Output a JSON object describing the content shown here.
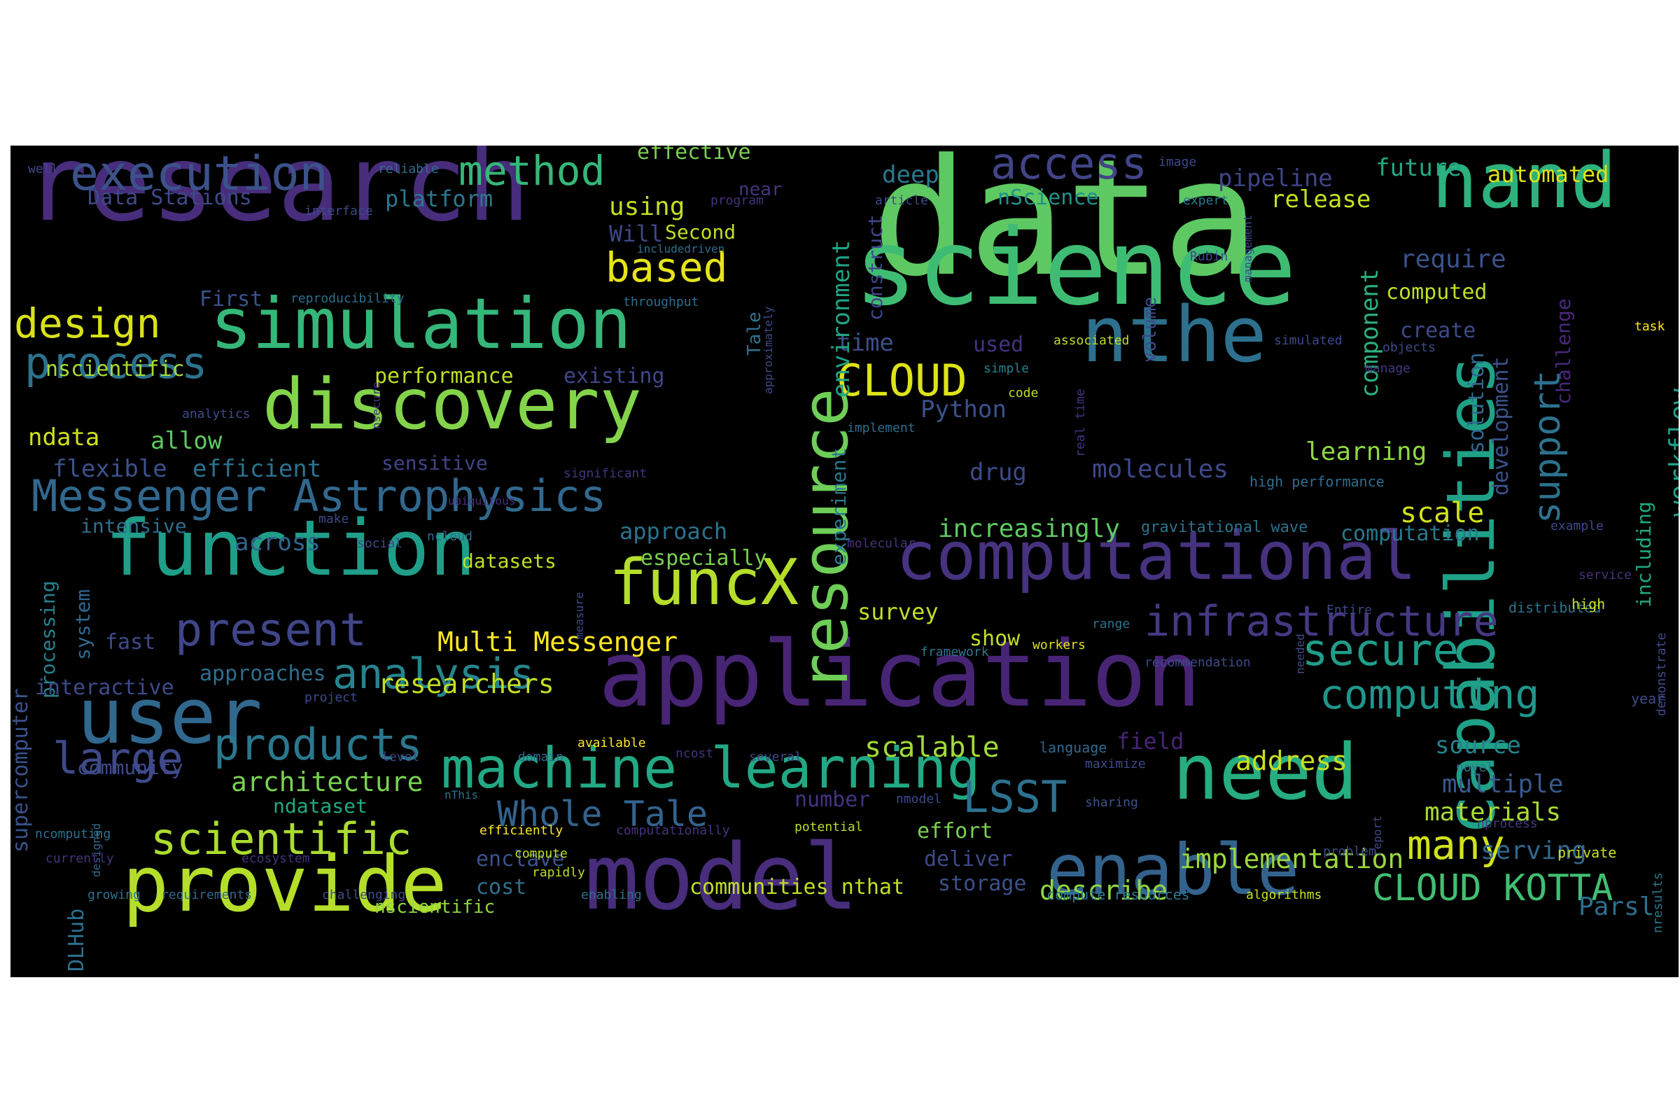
{
  "words": [
    {
      "text": "data",
      "color": "#5ec962"
    },
    {
      "text": "science",
      "color": "#3fbc73"
    },
    {
      "text": "research",
      "color": "#472d7b"
    },
    {
      "text": "application",
      "color": "#482475"
    },
    {
      "text": "model",
      "color": "#472d7b"
    },
    {
      "text": "function",
      "color": "#1f9e89"
    },
    {
      "text": "simulation",
      "color": "#35b779"
    },
    {
      "text": "discovery",
      "color": "#84d44b"
    },
    {
      "text": "computational",
      "color": "#46327e"
    },
    {
      "text": "capabilities",
      "color": "#1fa187"
    },
    {
      "text": "resource",
      "color": "#6ece58"
    },
    {
      "text": "nand",
      "color": "#2db27d"
    },
    {
      "text": "nthe",
      "color": "#2d708e"
    },
    {
      "text": "user",
      "color": "#31688e"
    },
    {
      "text": "provide",
      "color": "#b5de2b"
    },
    {
      "text": "enable",
      "color": "#33638d"
    },
    {
      "text": "need",
      "color": "#26ad81"
    },
    {
      "text": "funcX",
      "color": "#b5de2b"
    },
    {
      "text": "machine learning",
      "color": "#22a884"
    },
    {
      "text": "Messenger Astrophysics",
      "color": "#31688e"
    },
    {
      "text": "execution",
      "color": "#3b528b"
    },
    {
      "text": "access",
      "color": "#414487"
    },
    {
      "text": "infrastructure",
      "color": "#443983"
    },
    {
      "text": "present",
      "color": "#404688"
    },
    {
      "text": "large",
      "color": "#3e4a89"
    },
    {
      "text": "products",
      "color": "#2a788e"
    },
    {
      "text": "scientific",
      "color": "#addc30"
    },
    {
      "text": "analysis",
      "color": "#25858e"
    },
    {
      "text": "process",
      "color": "#2c728e"
    },
    {
      "text": "design",
      "color": "#d8e219"
    },
    {
      "text": "method",
      "color": "#35b779"
    },
    {
      "text": "based",
      "color": "#e5e419"
    },
    {
      "text": "CLOUD",
      "color": "#dde318"
    },
    {
      "text": "secure",
      "color": "#1f9e89"
    },
    {
      "text": "computing",
      "color": "#1f968b"
    },
    {
      "text": "many",
      "color": "#d0e11c"
    },
    {
      "text": "CLOUD KOTTA",
      "color": "#42be71"
    },
    {
      "text": "LSST",
      "color": "#2c728e"
    },
    {
      "text": "Whole Tale",
      "color": "#33638d"
    },
    {
      "text": "support",
      "color": "#2c728e"
    },
    {
      "text": "workflow",
      "color": "#1f9e89"
    },
    {
      "text": "Multi Messenger",
      "color": "#fde725"
    },
    {
      "text": "researchers",
      "color": "#c2df23"
    },
    {
      "text": "scalable",
      "color": "#a2da37"
    },
    {
      "text": "architecture",
      "color": "#7ad151"
    },
    {
      "text": "implementation",
      "color": "#9bd93c"
    },
    {
      "text": "describe",
      "color": "#90d743"
    },
    {
      "text": "address",
      "color": "#c8e020"
    },
    {
      "text": "multiple",
      "color": "#38588c"
    },
    {
      "text": "materials",
      "color": "#a8db34"
    },
    {
      "text": "serving",
      "color": "#31688e"
    },
    {
      "text": "Parsl",
      "color": "#2e6e8e"
    },
    {
      "text": "source",
      "color": "#26828e"
    },
    {
      "text": "learning",
      "color": "#90d743"
    },
    {
      "text": "molecules",
      "color": "#3e4989"
    },
    {
      "text": "increasingly",
      "color": "#5ec962"
    },
    {
      "text": "scale",
      "color": "#d2e21b"
    },
    {
      "text": "computation",
      "color": "#2a788e"
    },
    {
      "text": "drug",
      "color": "#3e4a89"
    },
    {
      "text": "Python",
      "color": "#3b528b"
    },
    {
      "text": "time",
      "color": "#3d4e8a"
    },
    {
      "text": "used",
      "color": "#46327e"
    },
    {
      "text": "deep",
      "color": "#2a788e"
    },
    {
      "text": "nScience",
      "color": "#21918c"
    },
    {
      "text": "pipeline",
      "color": "#414487"
    },
    {
      "text": "release",
      "color": "#c8e020"
    },
    {
      "text": "future",
      "color": "#22a884"
    },
    {
      "text": "automated",
      "color": "#dde318"
    },
    {
      "text": "require",
      "color": "#3b528b"
    },
    {
      "text": "computed",
      "color": "#bddf26"
    },
    {
      "text": "create",
      "color": "#3e4a89"
    },
    {
      "text": "component",
      "color": "#2db27d"
    },
    {
      "text": "solution",
      "color": "#31688e"
    },
    {
      "text": "development",
      "color": "#3b528b"
    },
    {
      "text": "challenge",
      "color": "#482878"
    },
    {
      "text": "including",
      "color": "#22a884"
    },
    {
      "text": "environment",
      "color": "#20a486"
    },
    {
      "text": "construct",
      "color": "#3f4788"
    },
    {
      "text": "experiment",
      "color": "#2a788e"
    },
    {
      "text": "volume",
      "color": "#3e4a89"
    },
    {
      "text": "effective",
      "color": "#7ad151"
    },
    {
      "text": "using",
      "color": "#c2df23"
    },
    {
      "text": "platform",
      "color": "#2a788e"
    },
    {
      "text": "Will",
      "color": "#404688"
    },
    {
      "text": "Second",
      "color": "#c0df25"
    },
    {
      "text": "near",
      "color": "#46337e"
    },
    {
      "text": "Data Stations",
      "color": "#3e4989"
    },
    {
      "text": "First",
      "color": "#3b528b"
    },
    {
      "text": "Tale",
      "color": "#2c728e"
    },
    {
      "text": "nscientific",
      "color": "#a5db36"
    },
    {
      "text": "performance",
      "color": "#bddf26"
    },
    {
      "text": "existing",
      "color": "#404688"
    },
    {
      "text": "ndata",
      "color": "#d0e11c"
    },
    {
      "text": "allow",
      "color": "#5ec962"
    },
    {
      "text": "flexible",
      "color": "#3b528b"
    },
    {
      "text": "efficient",
      "color": "#2c728e"
    },
    {
      "text": "sensitive",
      "color": "#414487"
    },
    {
      "text": "intensive",
      "color": "#2e6e8e"
    },
    {
      "text": "across",
      "color": "#33638d"
    },
    {
      "text": "approach",
      "color": "#2c728e"
    },
    {
      "text": "datasets",
      "color": "#bddf26"
    },
    {
      "text": "especially",
      "color": "#7ad151"
    },
    {
      "text": "system",
      "color": "#31688e"
    },
    {
      "text": "processing",
      "color": "#26828e"
    },
    {
      "text": "supercomputer",
      "color": "#3b528b"
    },
    {
      "text": "fast",
      "color": "#3e4a89"
    },
    {
      "text": "interactive",
      "color": "#3e4a89"
    },
    {
      "text": "approaches",
      "color": "#2e6e8e"
    },
    {
      "text": "community",
      "color": "#3e4a89"
    },
    {
      "text": "ndataset",
      "color": "#22a884"
    },
    {
      "text": "nscientific",
      "color": "#8fd744"
    },
    {
      "text": "cost",
      "color": "#2d708e"
    },
    {
      "text": "communities nthat",
      "color": "#c0df25"
    },
    {
      "text": "enclave",
      "color": "#3b528b"
    },
    {
      "text": "storage",
      "color": "#3b528b"
    },
    {
      "text": "deliver",
      "color": "#3e4a89"
    },
    {
      "text": "effort",
      "color": "#7ad151"
    },
    {
      "text": "number",
      "color": "#46337e"
    },
    {
      "text": "field",
      "color": "#482475"
    },
    {
      "text": "show",
      "color": "#c0df25"
    },
    {
      "text": "survey",
      "color": "#c0df25"
    },
    {
      "text": "DLHub",
      "color": "#2d708e"
    },
    {
      "text": "nprocess",
      "color": "#44397f"
    },
    {
      "text": "private",
      "color": "#c8e020"
    },
    {
      "text": "nresults",
      "color": "#2a788e"
    },
    {
      "text": "year",
      "color": "#3e4a89"
    },
    {
      "text": "demonstrate",
      "color": "#3e4a89"
    },
    {
      "text": "distributed",
      "color": "#2c728e"
    },
    {
      "text": "service",
      "color": "#46327e"
    },
    {
      "text": "high",
      "color": "#c8e020"
    },
    {
      "text": "example",
      "color": "#3e4a89"
    },
    {
      "text": "task",
      "color": "#fde725"
    },
    {
      "text": "gravitational wave",
      "color": "#2c728e"
    },
    {
      "text": "high performance",
      "color": "#2e6e8e"
    },
    {
      "text": "real time",
      "color": "#46327e"
    },
    {
      "text": "compute resources",
      "color": "#2a788e"
    },
    {
      "text": "algorithms",
      "color": "#c8e020"
    },
    {
      "text": "rapidly",
      "color": "#bddf26"
    },
    {
      "text": "compute",
      "color": "#bddf26"
    },
    {
      "text": "enabling",
      "color": "#2e6e8e"
    },
    {
      "text": "challenging",
      "color": "#3e4a89"
    },
    {
      "text": "requirements",
      "color": "#31688e"
    },
    {
      "text": "growing",
      "color": "#2c728e"
    },
    {
      "text": "designed",
      "color": "#31688e"
    },
    {
      "text": "ecosystem",
      "color": "#46327e"
    },
    {
      "text": "efficiently",
      "color": "#fde725"
    },
    {
      "text": "computationally",
      "color": "#46337e"
    },
    {
      "text": "potential",
      "color": "#b5de2b"
    },
    {
      "text": "sharing",
      "color": "#3b528b"
    },
    {
      "text": "problem",
      "color": "#3e4a89"
    },
    {
      "text": "report",
      "color": "#3e4a89"
    },
    {
      "text": "novel",
      "color": "#2a788e"
    },
    {
      "text": "maximize",
      "color": "#3e4a89"
    },
    {
      "text": "language",
      "color": "#31688e"
    },
    {
      "text": "nmodel",
      "color": "#3e4a89"
    },
    {
      "text": "nThis",
      "color": "#2c728e"
    },
    {
      "text": "several",
      "color": "#3e4a89"
    },
    {
      "text": "ncost",
      "color": "#46327e"
    },
    {
      "text": "available",
      "color": "#fde725"
    },
    {
      "text": "domain",
      "color": "#31688e"
    },
    {
      "text": "recommendation",
      "color": "#3e4a89"
    },
    {
      "text": "range",
      "color": "#2c728e"
    },
    {
      "text": "workers",
      "color": "#dde318"
    },
    {
      "text": "framework",
      "color": "#2a788e"
    },
    {
      "text": "Entire",
      "color": "#3e4a89"
    },
    {
      "text": "measure",
      "color": "#3e4a89"
    },
    {
      "text": "molecular",
      "color": "#46327e"
    },
    {
      "text": "social",
      "color": "#3e4a89"
    },
    {
      "text": "ncloud",
      "color": "#31688e"
    },
    {
      "text": "ubiquitous",
      "color": "#46327e"
    },
    {
      "text": "make",
      "color": "#3e4a89"
    },
    {
      "text": "significant",
      "color": "#46327e"
    },
    {
      "text": "implement",
      "color": "#2e6e8e"
    },
    {
      "text": "simple",
      "color": "#26828e"
    },
    {
      "text": "code",
      "color": "#bddf26"
    },
    {
      "text": "manage",
      "color": "#44397f"
    },
    {
      "text": "simulated",
      "color": "#3e4a89"
    },
    {
      "text": "objects",
      "color": "#3e4a89"
    },
    {
      "text": "associated",
      "color": "#c0df25"
    },
    {
      "text": "management",
      "color": "#3e4a89"
    },
    {
      "text": "Rubin",
      "color": "#3e4a89"
    },
    {
      "text": "expert",
      "color": "#2a788e"
    },
    {
      "text": "article",
      "color": "#3e4a89"
    },
    {
      "text": "image",
      "color": "#3e4a89"
    },
    {
      "text": "program",
      "color": "#46327e"
    },
    {
      "text": "includedriven",
      "color": "#2e6e8e"
    },
    {
      "text": "throughput",
      "color": "#2e6e8e"
    },
    {
      "text": "approximately",
      "color": "#3e4a89"
    },
    {
      "text": "reproducibility",
      "color": "#2e6e8e"
    },
    {
      "text": "reliable",
      "color": "#2e6e8e"
    },
    {
      "text": "interface",
      "color": "#3e4a89"
    },
    {
      "text": "well",
      "color": "#3e4a89"
    },
    {
      "text": "analytics",
      "color": "#3e4a89"
    },
    {
      "text": "nsecure",
      "color": "#46327e"
    },
    {
      "text": "level",
      "color": "#3e4a89"
    },
    {
      "text": "project",
      "color": "#3e4a89"
    },
    {
      "text": "ncomputing",
      "color": "#2c728e"
    },
    {
      "text": "currently",
      "color": "#46327e"
    },
    {
      "text": "needed",
      "color": "#3e4a89"
    }
  ]
}
